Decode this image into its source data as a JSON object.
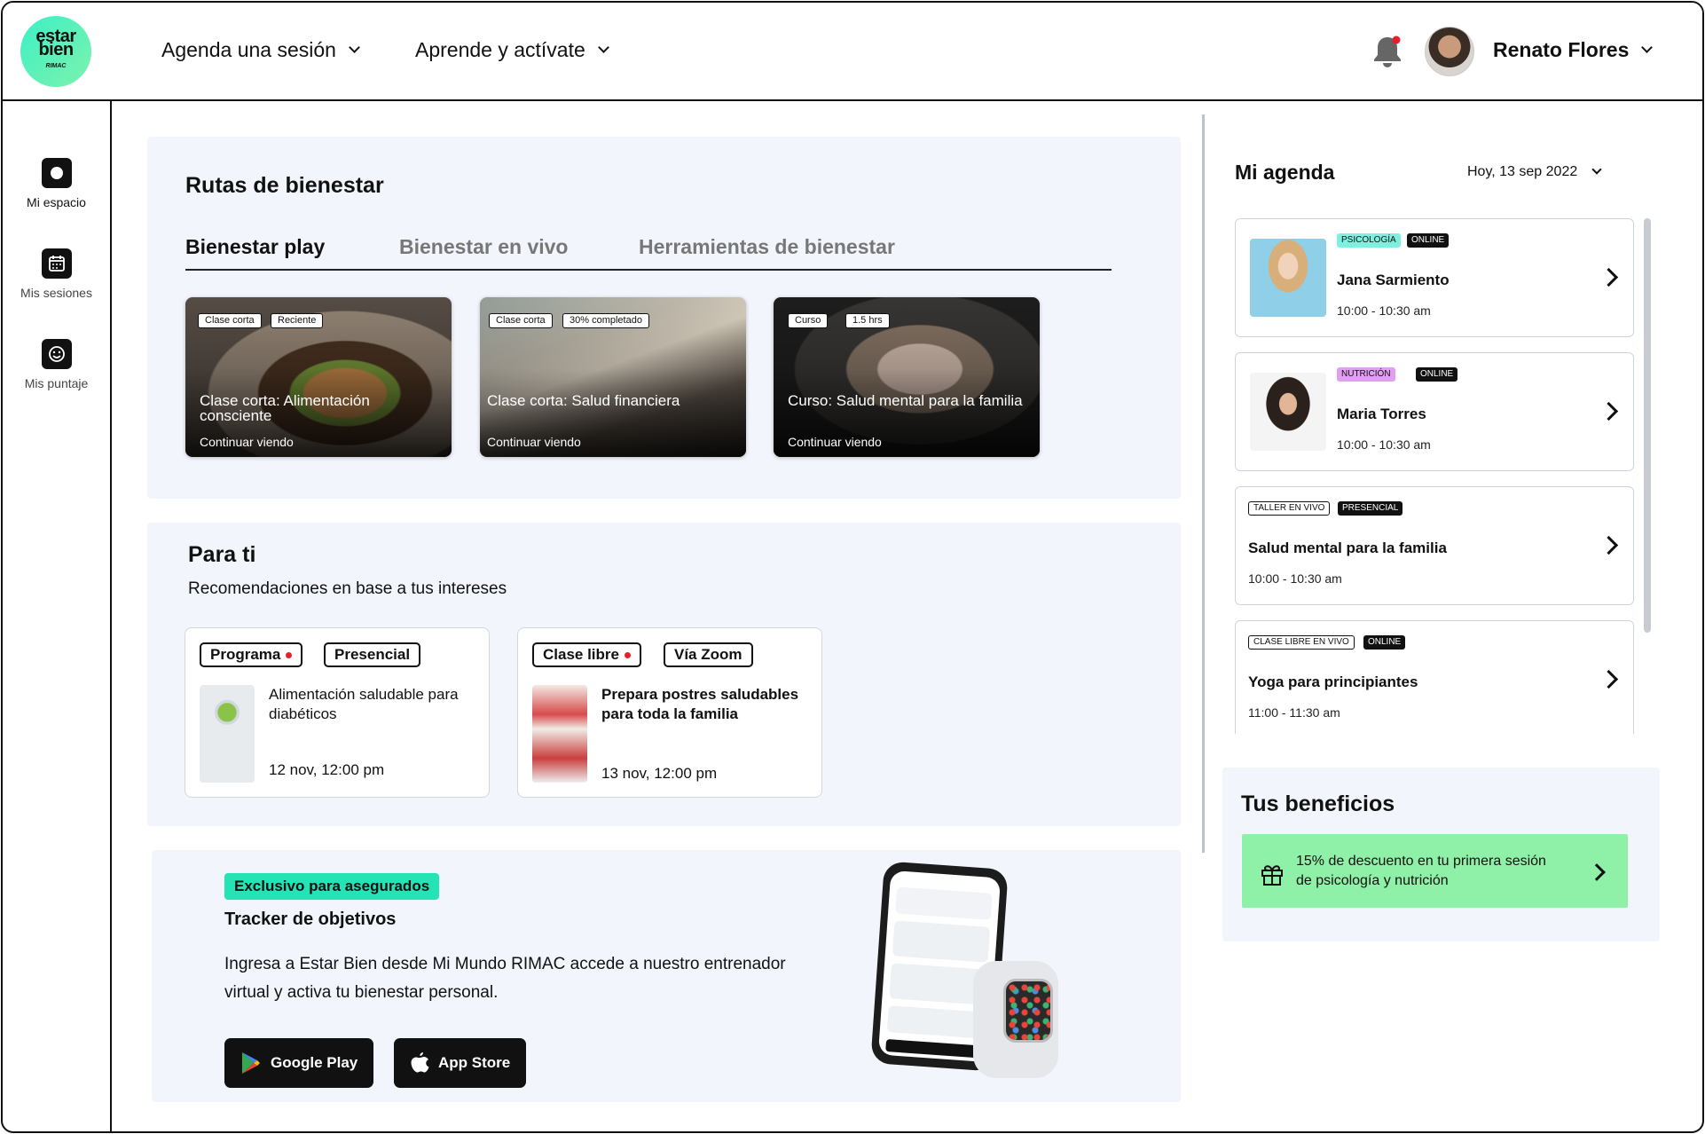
{
  "header": {
    "logo": {
      "line1": "estar",
      "line2": "bien",
      "line3": "RIMAC"
    },
    "nav": [
      {
        "label": "Agenda una sesión"
      },
      {
        "label": "Aprende y actívate"
      }
    ],
    "user_name": "Renato Flores"
  },
  "sidebar": {
    "items": [
      {
        "label": "Mi espacio",
        "icon": "circle-icon"
      },
      {
        "label": "Mis sesiones",
        "icon": "calendar-icon"
      },
      {
        "label": "Mis puntaje",
        "icon": "smiley-icon"
      }
    ]
  },
  "rutas": {
    "title": "Rutas de bienestar",
    "tabs": [
      {
        "label": "Bienestar  play",
        "active": true
      },
      {
        "label": "Bienestar en vivo",
        "active": false
      },
      {
        "label": "Herramientas de bienestar",
        "active": false
      }
    ],
    "cards": [
      {
        "tags": [
          "Clase corta",
          "Reciente"
        ],
        "title": "Clase corta: Alimentación consciente",
        "cta": "Continuar viendo"
      },
      {
        "tags": [
          "Clase corta",
          "30% completado"
        ],
        "title": "Clase corta:  Salud financiera",
        "cta": "Continuar viendo"
      },
      {
        "tags": [
          "Curso",
          "1.5 hrs"
        ],
        "title": "Curso: Salud mental para la familia",
        "cta": "Continuar viendo"
      }
    ]
  },
  "para_ti": {
    "title": "Para ti",
    "subtitle": "Recomendaciones en base a tus intereses",
    "cards": [
      {
        "tag1": "Programa",
        "tag2": "Presencial",
        "title": "Alimentación saludable para diabéticos",
        "date": "12 nov, 12:00 pm"
      },
      {
        "tag1": "Clase libre",
        "tag2": "Vía Zoom",
        "title": "Prepara postres saludables para toda la familia",
        "date": "13 nov, 12:00 pm"
      }
    ]
  },
  "promo": {
    "badge": "Exclusivo para asegurados",
    "title": "Tracker de objetivos",
    "text": "Ingresa a Estar Bien desde Mi Mundo RIMAC accede a nuestro entrenador virtual y activa tu bienestar personal.",
    "google_play": "Google Play",
    "app_store": "App Store"
  },
  "agenda": {
    "title": "Mi agenda",
    "date_filter": "Hoy, 13 sep 2022",
    "items": [
      {
        "badges": [
          "Psicología",
          "Online"
        ],
        "name": "Jana Sarmiento",
        "time": "10:00 - 10:30 am"
      },
      {
        "badges": [
          "Nutrición",
          "Online"
        ],
        "name": "Maria Torres",
        "time": "10:00 - 10:30 am"
      },
      {
        "badges": [
          "Taller en vivo",
          "Presencial"
        ],
        "name": "Salud mental para la familia",
        "time": "10:00 - 10:30 am"
      },
      {
        "badges": [
          "Clase libre en vivo",
          "Online"
        ],
        "name": "Yoga para principiantes",
        "time": "11:00 - 11:30 am"
      }
    ]
  },
  "beneficios": {
    "title": "Tus beneficios",
    "text": "15% de descuento en tu primera sesión de psicología y nutrición"
  },
  "colors": {
    "brand_mint": "#3cf0c6",
    "benefit_green": "#8ff0a7",
    "panel_bg": "#f2f6fc",
    "psicologia": "#7df0df",
    "nutricion": "#e29ef2",
    "notification_red": "#e5202a"
  }
}
